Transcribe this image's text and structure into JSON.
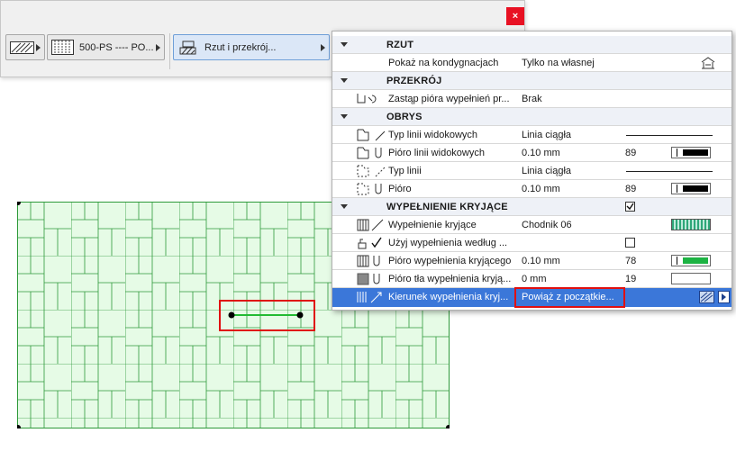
{
  "toolbar": {
    "close_label": "×",
    "fill_button_label": "500-PS ---- PO...",
    "view_button_label": "Rzut i przekrój..."
  },
  "panel": {
    "sections": {
      "rzut": "RZUT",
      "przekroj": "PRZEKRÓJ",
      "obrys": "OBRYS",
      "wypelnienie": "WYPEŁNIENIE KRYJĄCE"
    },
    "rows": {
      "show_on_floor": {
        "label": "Pokaż na kondygnacjach",
        "value": "Tylko na własnej"
      },
      "override_pens": {
        "label": "Zastąp pióra wypełnień pr...",
        "value": "Brak"
      },
      "view_line_type": {
        "label": "Typ linii widokowych",
        "value": "Linia ciągła"
      },
      "view_line_pen": {
        "label": "Pióro linii widokowych",
        "value": "0.10 mm",
        "pen_number": "89"
      },
      "line_type": {
        "label": "Typ linii",
        "value": "Linia ciągła"
      },
      "pen": {
        "label": "Pióro",
        "value": "0.10 mm",
        "pen_number": "89"
      },
      "cover_fill": {
        "label": "Wypełnienie kryjące",
        "value": "Chodnik 06"
      },
      "use_fill_by": {
        "label": "Użyj wypełnienia według ..."
      },
      "cover_fill_pen": {
        "label": "Pióro wypełnienia kryjącego",
        "value": "0.10 mm",
        "pen_number": "78"
      },
      "cover_bg_pen": {
        "label": "Pióro tła wypełnienia kryją...",
        "value": "0 mm",
        "pen_number": "19"
      },
      "fill_direction": {
        "label": "Kierunek wypełnienia kryj...",
        "value": "Powiąż z początkie..."
      }
    }
  },
  "colors": {
    "selection": "#3b77d9",
    "highlight_red": "#e01010",
    "fill_green": "#e6fbe6",
    "fill_line_green": "#2e9a3a",
    "pen_green": "#1db343"
  },
  "icons": [
    "hatch-fill-icon",
    "brick-fill-icon",
    "floor-plan-section-icon",
    "story-icon",
    "pen-override-icon",
    "view-line-icon",
    "line-type-icon",
    "fill-pattern-icon",
    "fill-source-icon",
    "fill-pen-icon",
    "background-pen-icon",
    "fill-direction-icon"
  ]
}
